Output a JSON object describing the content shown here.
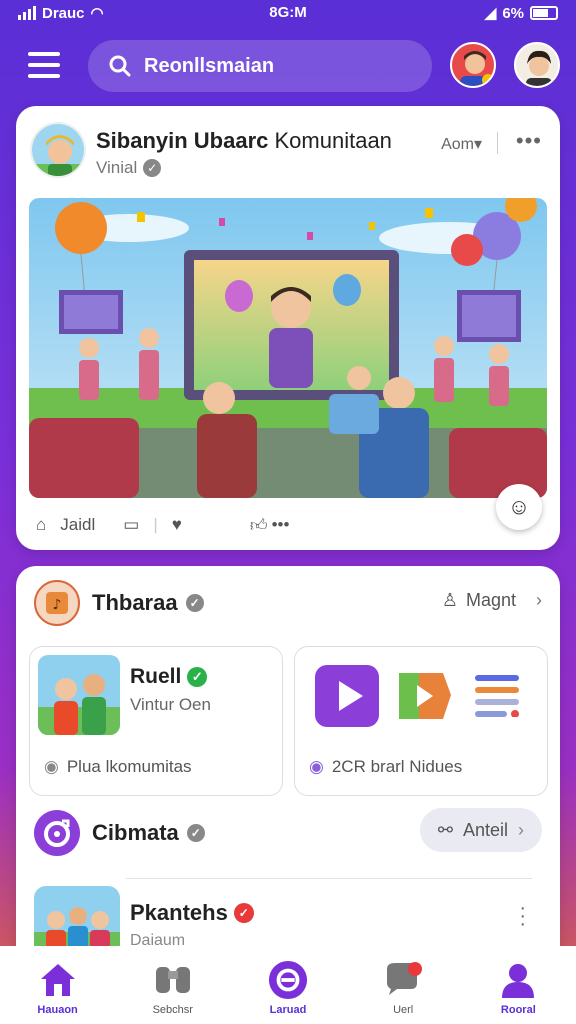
{
  "status_bar": {
    "carrier": "Drauc",
    "time": "8G:M",
    "battery": "6%"
  },
  "header": {
    "search_value": "Reonllsmaian"
  },
  "post": {
    "title_bold": "Sibanyin Ubaarc",
    "title_rest": " Komunitaan",
    "subtitle": "Vinial",
    "action": "Aom▾",
    "more": "•••",
    "actions": {
      "like": "Jaidl",
      "react": "•••"
    }
  },
  "section1": {
    "title": "Thbaraa",
    "right_label": "Magnt",
    "tile_left": {
      "title": "Ruell",
      "subtitle": "Vintur Oen",
      "footer": "Plua lkomumitas"
    },
    "tile_right": {
      "footer": "2CR brarl Nidues"
    }
  },
  "section2": {
    "title": "Cibmata",
    "pill": "Anteil"
  },
  "row": {
    "title": "Pkantehs",
    "subtitle": "Daiaum"
  },
  "bottom_nav": [
    {
      "label": "Hauaon"
    },
    {
      "label": "Sebchsr"
    },
    {
      "label": "Laruad"
    },
    {
      "label": "Uerl"
    },
    {
      "label": "Rooral"
    }
  ],
  "colors": {
    "brand": "#5a2fd6",
    "accent_orange": "#e0663a",
    "verified_green": "#2ab24a"
  }
}
